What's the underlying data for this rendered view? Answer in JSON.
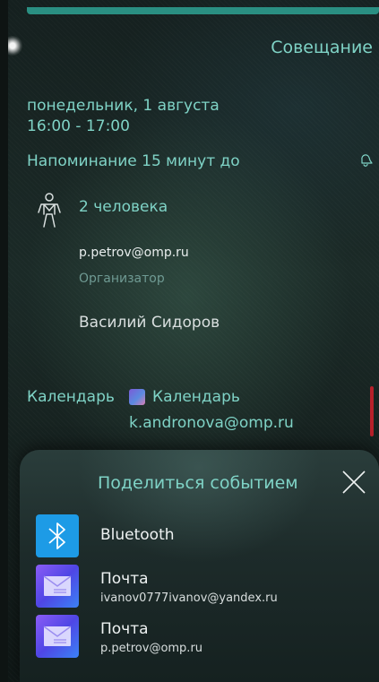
{
  "event": {
    "title": "Совещание",
    "date": "понедельник, 1 августа",
    "time": "16:00 - 17:00",
    "reminder": "Напоминание 15 минут до",
    "people_count": "2 человека",
    "organizer_email": "p.petrov@omp.ru",
    "organizer_role": "Организатор",
    "attendee": "Василий Сидоров",
    "calendar_label": "Календарь",
    "calendar_name": "Календарь",
    "calendar_email": "k.andronova@omp.ru"
  },
  "share_sheet": {
    "title": "Поделиться событием",
    "options": [
      {
        "icon": "bluetooth-icon",
        "title": "Bluetooth",
        "subtitle": ""
      },
      {
        "icon": "mail-icon",
        "title": "Почта",
        "subtitle": "ivanov0777ivanov@yandex.ru"
      },
      {
        "icon": "mail-icon",
        "title": "Почта",
        "subtitle": "p.petrov@omp.ru"
      }
    ]
  },
  "colors": {
    "accent": "#7fd3c6",
    "top_bar": "#2a8f82",
    "scroll_indicator": "#b7202a",
    "bluetooth": "#1d9be6"
  }
}
